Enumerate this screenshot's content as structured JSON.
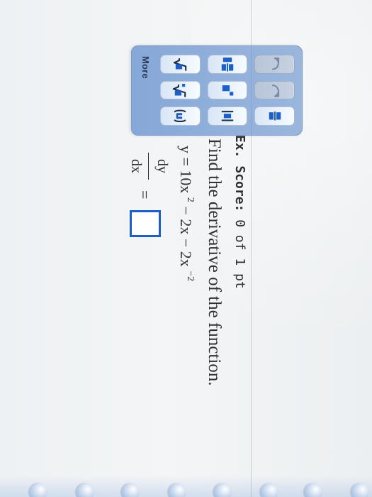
{
  "toolbar": {
    "more_label": "More",
    "buttons": [
      {
        "name": "undo-button",
        "icon": "undo-icon",
        "state": "dim"
      },
      {
        "name": "redo-button",
        "icon": "redo-icon",
        "state": "dim"
      },
      {
        "name": "fraction-button",
        "icon": "fraction-icon",
        "state": "enabled"
      },
      {
        "name": "mixed-fraction-button",
        "icon": "mixed-fraction-icon",
        "state": "enabled"
      },
      {
        "name": "exponent-button",
        "icon": "exponent-icon",
        "state": "enabled"
      },
      {
        "name": "absolute-value-button",
        "icon": "absolute-value-icon",
        "state": "enabled"
      },
      {
        "name": "sqrt-button",
        "icon": "sqrt-icon",
        "state": "enabled"
      },
      {
        "name": "nth-root-button",
        "icon": "nth-root-icon",
        "state": "enabled"
      },
      {
        "name": "subscript-button",
        "icon": "subscript-icon",
        "state": "enabled"
      },
      {
        "name": "ordered-pair-button",
        "icon": "ordered-pair-icon",
        "state": "enabled"
      }
    ]
  },
  "exercise": {
    "score_label": "Ex. Score:",
    "score_value": "0 of 1 pt",
    "prompt": "Find the derivative of the function.",
    "equation": {
      "lhs": "y",
      "rhs_text_1": "= 10x",
      "exp_1": "2",
      "rhs_text_2": "− 2x − 2x",
      "exp_2": "−2"
    },
    "derivative": {
      "numerator": "dy",
      "denominator": "dx",
      "equals": "="
    }
  }
}
